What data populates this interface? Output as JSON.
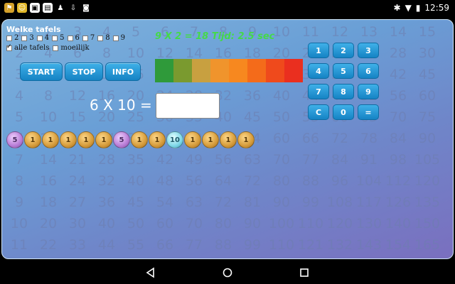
{
  "status_bar": {
    "time": "12:59"
  },
  "app": {
    "section_title": "Welke tafels",
    "tables": [
      {
        "label": "2",
        "checked": false
      },
      {
        "label": "3",
        "checked": false
      },
      {
        "label": "4",
        "checked": false
      },
      {
        "label": "5",
        "checked": false
      },
      {
        "label": "6",
        "checked": false
      },
      {
        "label": "7",
        "checked": false
      },
      {
        "label": "8",
        "checked": false
      },
      {
        "label": "9",
        "checked": false
      }
    ],
    "all_tables_label": "alle tafels",
    "all_tables_checked": true,
    "difficult_label": "moeilijk",
    "difficult_checked": false,
    "start_label": "START",
    "stop_label": "STOP",
    "info_label": "INFO",
    "feedback": "9 X 2 = 18 Tijd: 2.5 sec",
    "question": "6 X 10 =",
    "answer_value": "",
    "timebar_colors": [
      "#2f9a3a",
      "#7a9a2f",
      "#c8a040",
      "#f0942c",
      "#f7881f",
      "#f46b1a",
      "#ef4a1c",
      "#ea2f1f"
    ],
    "coins": [
      "5",
      "1",
      "1",
      "1",
      "1",
      "1",
      "5",
      "1",
      "1",
      "10",
      "1",
      "1",
      "1",
      "1"
    ],
    "coin_kinds": [
      "purple",
      "gold",
      "gold",
      "gold",
      "gold",
      "gold",
      "purple",
      "gold",
      "gold",
      "cyan",
      "gold",
      "gold",
      "gold",
      "gold"
    ],
    "keypad": [
      "1",
      "2",
      "3",
      "4",
      "5",
      "6",
      "7",
      "8",
      "9",
      "C",
      "0",
      "="
    ]
  }
}
